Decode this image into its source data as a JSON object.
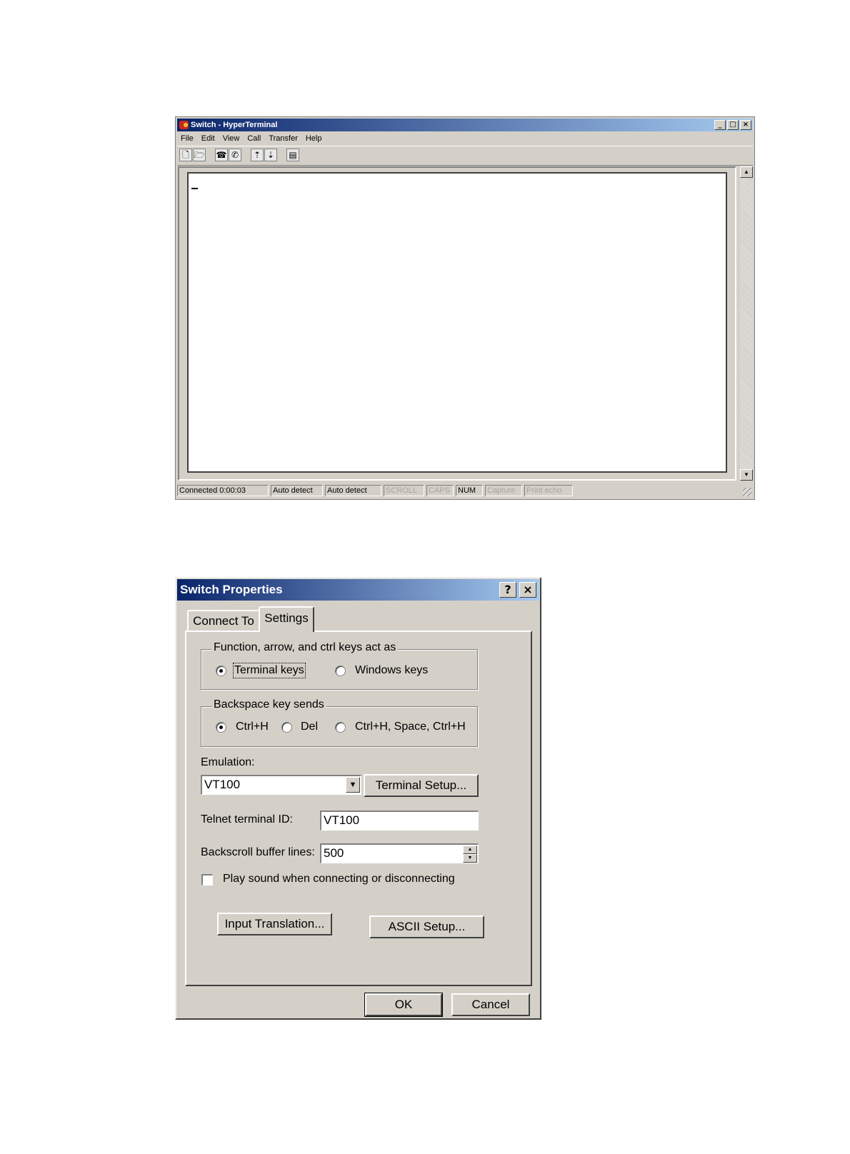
{
  "terminal_window": {
    "title": "Switch - HyperTerminal",
    "menu": [
      "File",
      "Edit",
      "View",
      "Call",
      "Transfer",
      "Help"
    ],
    "toolbar_icons": [
      "new-icon",
      "open-icon",
      "call-icon",
      "disconnect-icon",
      "send-icon",
      "receive-icon",
      "properties-icon"
    ],
    "status": {
      "connected": "Connected 0:00:03",
      "detect1": "Auto detect",
      "detect2": "Auto detect",
      "scroll": "SCROLL",
      "caps": "CAPS",
      "num": "NUM",
      "capture": "Capture",
      "print_echo": "Print echo"
    }
  },
  "dialog": {
    "title": "Switch Properties",
    "tabs": [
      "Connect To",
      "Settings"
    ],
    "keys_group": {
      "legend": "Function, arrow, and ctrl keys act as",
      "terminal_keys": "Terminal keys",
      "windows_keys": "Windows keys",
      "selected": "Terminal keys"
    },
    "backspace_group": {
      "legend": "Backspace key sends",
      "ctrl_h": "Ctrl+H",
      "del": "Del",
      "ctrl_h_space": "Ctrl+H, Space, Ctrl+H",
      "selected": "Ctrl+H"
    },
    "emulation_label": "Emulation:",
    "emulation_value": "VT100",
    "terminal_setup_button": "Terminal Setup...",
    "telnet_id_label": "Telnet terminal ID:",
    "telnet_id_value": "VT100",
    "backscroll_label": "Backscroll buffer lines:",
    "backscroll_value": "500",
    "play_sound_label": "Play sound when connecting or disconnecting",
    "play_sound_checked": false,
    "input_translation_button": "Input Translation...",
    "ascii_setup_button": "ASCII Setup...",
    "ok_button": "OK",
    "cancel_button": "Cancel"
  },
  "colors": {
    "title_start": "#0a246a",
    "title_end": "#a6caf0",
    "face": "#d4d0c8"
  }
}
